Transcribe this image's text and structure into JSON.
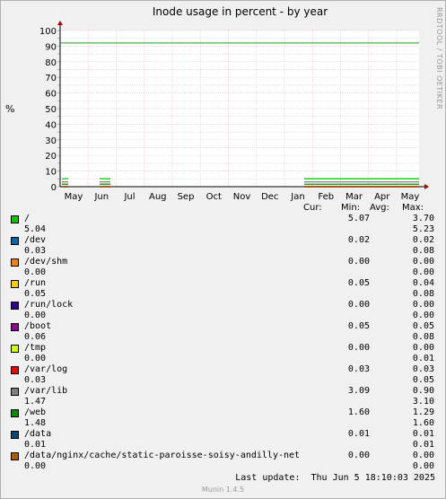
{
  "title": "Inode usage in percent - by year",
  "vendor": "RRDTOOL / TOBI OETIKER",
  "footer_version": "Munin 1.4.5",
  "last_update_label": "Last update:",
  "last_update": "Thu Jun  5 18:10:03 2025",
  "table_header": {
    "cur": "Cur:",
    "min": "Min:",
    "avg": "Avg:",
    "max": "Max:"
  },
  "chart_data": {
    "type": "line",
    "title": "Inode usage in percent - by year",
    "xlabel": "",
    "ylabel": "%",
    "ylim": [
      0,
      100
    ],
    "yticks": [
      "0",
      "5",
      "10",
      "15",
      "20",
      "25",
      "30",
      "35",
      "40",
      "45",
      "50",
      "55",
      "60",
      "65",
      "70",
      "75",
      "80",
      "85",
      "90",
      "95",
      "100"
    ],
    "x_ticks": [
      "May",
      "Jun",
      "Jul",
      "Aug",
      "Sep",
      "Oct",
      "Nov",
      "Dec",
      "Jan",
      "Feb",
      "Mar",
      "Apr",
      "May"
    ],
    "threshold": 92,
    "threshold_color": "#1aa01a",
    "grid": true,
    "series": [
      {
        "name": "/",
        "color": "#00cc00",
        "cur": "5.07",
        "min": "3.70",
        "avg": "5.04",
        "max": "5.23"
      },
      {
        "name": "/dev",
        "color": "#0066b3",
        "cur": "0.02",
        "min": "0.02",
        "avg": "0.03",
        "max": "0.08"
      },
      {
        "name": "/dev/shm",
        "color": "#ff8000",
        "cur": "0.00",
        "min": "0.00",
        "avg": "0.00",
        "max": "0.00"
      },
      {
        "name": "/run",
        "color": "#ffcc00",
        "cur": "0.05",
        "min": "0.04",
        "avg": "0.05",
        "max": "0.08"
      },
      {
        "name": "/run/lock",
        "color": "#330099",
        "cur": "0.00",
        "min": "0.00",
        "avg": "0.00",
        "max": "0.00"
      },
      {
        "name": "/boot",
        "color": "#990099",
        "cur": "0.05",
        "min": "0.05",
        "avg": "0.06",
        "max": "0.08"
      },
      {
        "name": "/tmp",
        "color": "#ccff00",
        "cur": "0.00",
        "min": "0.00",
        "avg": "0.00",
        "max": "0.01"
      },
      {
        "name": "/var/log",
        "color": "#ff0000",
        "cur": "0.03",
        "min": "0.03",
        "avg": "0.03",
        "max": "0.05"
      },
      {
        "name": "/var/lib",
        "color": "#808080",
        "cur": "3.09",
        "min": "0.90",
        "avg": "1.47",
        "max": "3.10"
      },
      {
        "name": "/web",
        "color": "#008f00",
        "cur": "1.60",
        "min": "1.29",
        "avg": "1.48",
        "max": "1.60"
      },
      {
        "name": "/data",
        "color": "#00487d",
        "cur": "0.01",
        "min": "0.01",
        "avg": "0.01",
        "max": "0.01"
      },
      {
        "name": "/data/nginx/cache/static-paroisse-soisy-andilly-net",
        "color": "#b35a00",
        "cur": "0.00",
        "min": "0.00",
        "avg": "0.00",
        "max": "0.00"
      }
    ]
  }
}
